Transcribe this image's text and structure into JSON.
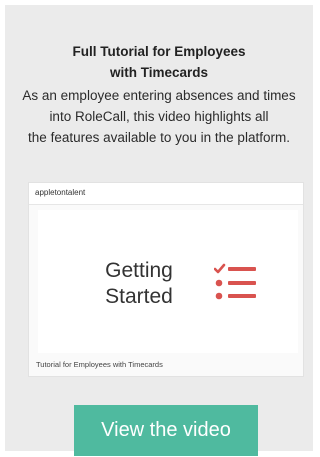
{
  "header": {
    "title_line1": "Full Tutorial for Employees",
    "title_line2": "with Timecards"
  },
  "description": {
    "line1": "As an employee entering absences and times",
    "line2": "into RoleCall, this video highlights all",
    "line3": "the features available to you in the platform."
  },
  "video": {
    "channel_name": "appletontalent",
    "slide_line1": "Getting",
    "slide_line2": "Started",
    "caption": "Tutorial for Employees with Timecards",
    "icon": "checklist-icon"
  },
  "cta": {
    "label": "View the video"
  },
  "colors": {
    "card_bg": "#ebebeb",
    "accent": "#4fba9f",
    "icon_red": "#d9534f"
  }
}
